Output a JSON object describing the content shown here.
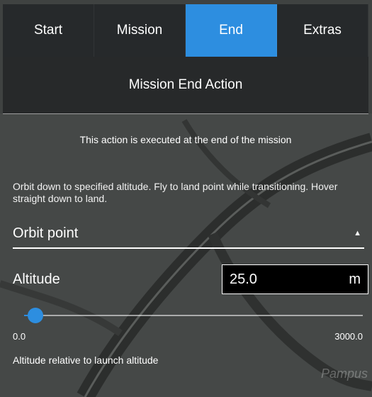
{
  "tabs": [
    {
      "label": "Start",
      "active": false
    },
    {
      "label": "Mission",
      "active": false
    },
    {
      "label": "End",
      "active": true
    },
    {
      "label": "Extras",
      "active": false
    }
  ],
  "section_title": "Mission End Action",
  "note": "This action is executed at the end of the mission",
  "description": "Orbit down to specified altitude. Fly to land point while transitioning. Hover straight down to land.",
  "end_action_select": {
    "value": "Orbit point"
  },
  "altitude": {
    "label": "Altitude",
    "value": "25.0",
    "unit": "m",
    "min_label": "0.0",
    "max_label": "3000.0",
    "min": 0.0,
    "max": 3000.0,
    "current": 25.0,
    "help": "Altitude relative to launch altitude"
  },
  "map_watermark": "Pampus",
  "colors": {
    "accent": "#2d8ee0",
    "panel": "#232628"
  }
}
